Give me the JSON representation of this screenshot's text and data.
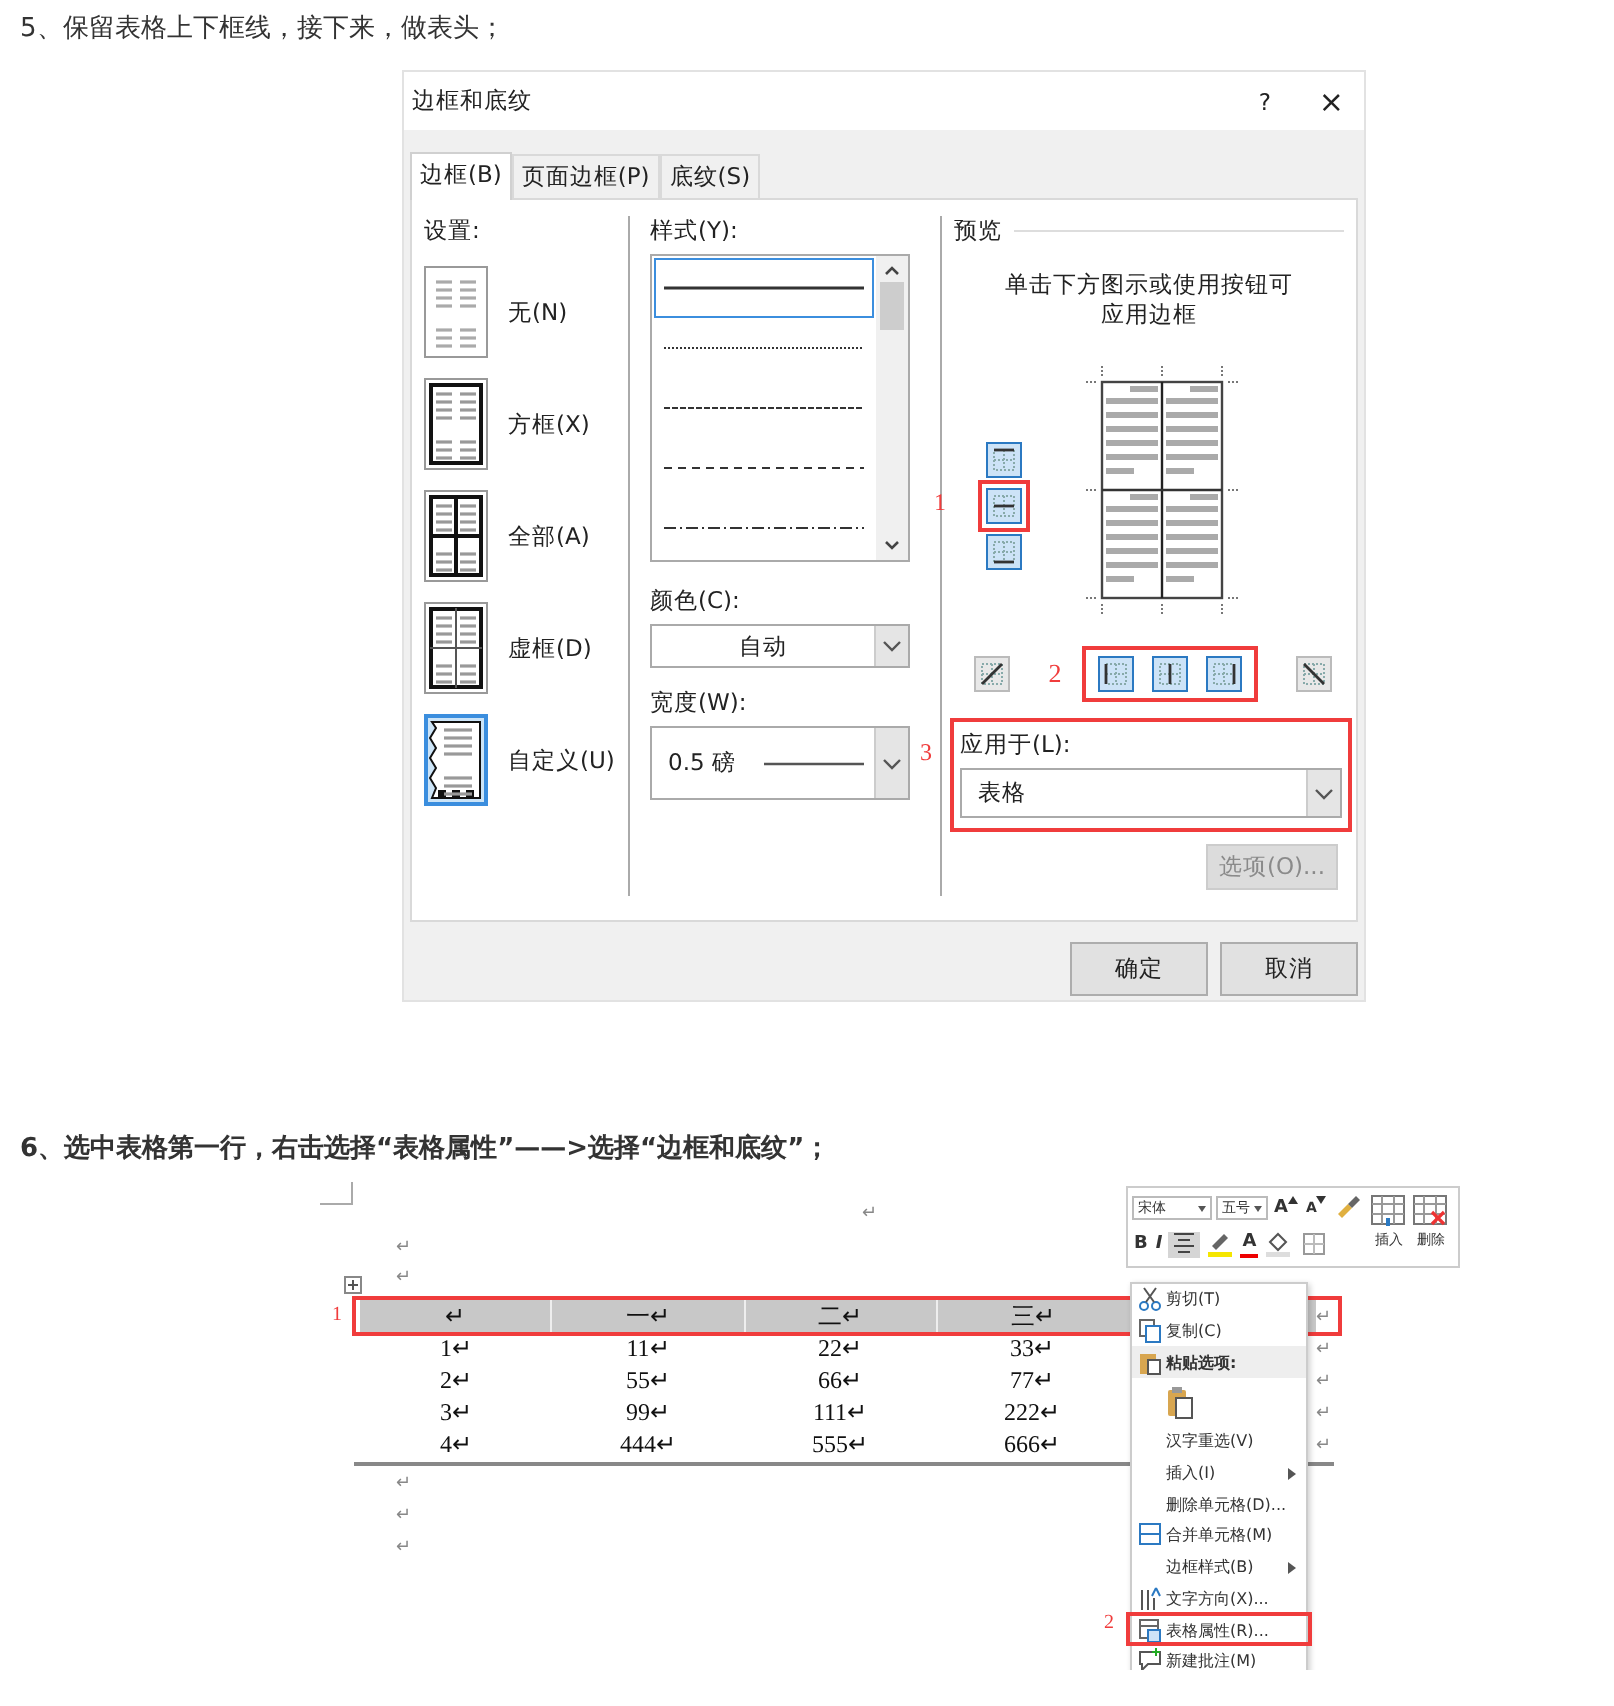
{
  "step5": {
    "text": "5、保留表格上下框线，接下来，做表头；"
  },
  "dialog": {
    "title": "边框和底纹",
    "help": "?",
    "close": "×",
    "tabs": [
      {
        "label": "边框(B)",
        "selected": true
      },
      {
        "label": "页面边框(P)",
        "selected": false
      },
      {
        "label": "底纹(S)",
        "selected": false
      }
    ],
    "settings": {
      "label": "设置:",
      "items": [
        {
          "label": "无(N)",
          "kind": "none",
          "selected": false
        },
        {
          "label": "方框(X)",
          "kind": "box",
          "selected": false
        },
        {
          "label": "全部(A)",
          "kind": "all",
          "selected": false
        },
        {
          "label": "虚框(D)",
          "kind": "grid",
          "selected": false
        },
        {
          "label": "自定义(U)",
          "kind": "custom",
          "selected": true
        }
      ]
    },
    "style": {
      "label": "样式(Y):",
      "options": [
        {
          "kind": "solid",
          "selected": true
        },
        {
          "kind": "dotted",
          "selected": false
        },
        {
          "kind": "fine-dash",
          "selected": false
        },
        {
          "kind": "dash",
          "selected": false
        },
        {
          "kind": "dash-dot",
          "selected": false
        }
      ]
    },
    "color": {
      "label": "颜色(C):",
      "value": "自动"
    },
    "width": {
      "label": "宽度(W):",
      "value": "0.5 磅"
    },
    "preview": {
      "label": "预览",
      "hint": "单击下方图示或使用按钮可应用边框"
    },
    "side_buttons": [
      {
        "kind": "top",
        "on": true
      },
      {
        "kind": "inside-h",
        "on": true
      },
      {
        "kind": "bottom",
        "on": true
      }
    ],
    "bottom_buttons": [
      {
        "kind": "diag-up",
        "on": false
      },
      {
        "kind": "left",
        "on": true
      },
      {
        "kind": "inside-v",
        "on": true
      },
      {
        "kind": "right",
        "on": true
      },
      {
        "kind": "diag-down",
        "on": false
      }
    ],
    "apply_to": {
      "label": "应用于(L):",
      "value": "表格"
    },
    "options_button": {
      "label": "选项(O)...",
      "disabled": true
    },
    "buttons": [
      {
        "label": "确定"
      },
      {
        "label": "取消"
      }
    ],
    "annotations": [
      "1",
      "2",
      "3"
    ]
  },
  "step6": {
    "text": "6、选中表格第一行，右击选择“表格属性”——>选择“边框和底纹”；"
  },
  "word": {
    "top_mark": "↵",
    "paragraphs_before": [
      "↵",
      "↵"
    ],
    "table": {
      "rows": [
        {
          "selected": true,
          "cells": [
            "↵",
            "一↵",
            "二↵",
            "三↵"
          ],
          "end": "↵"
        },
        {
          "selected": false,
          "cells": [
            "1↵",
            "11↵",
            "22↵",
            "33↵"
          ],
          "end": "↵"
        },
        {
          "selected": false,
          "cells": [
            "2↵",
            "55↵",
            "66↵",
            "77↵"
          ],
          "end": "↵"
        },
        {
          "selected": false,
          "cells": [
            "3↵",
            "99↵",
            "111↵",
            "222↵"
          ],
          "end": "↵"
        },
        {
          "selected": false,
          "cells": [
            "4↵",
            "444↵",
            "555↵",
            "666↵"
          ],
          "end": "↵"
        }
      ]
    },
    "paragraphs_after": [
      "↵",
      "↵",
      "↵"
    ],
    "mini_toolbar": {
      "font": "宋体",
      "size": "五号",
      "row1": [
        {
          "kind": "grow",
          "glyph": "A",
          "on": false
        },
        {
          "kind": "shrink",
          "glyph": "A",
          "on": false
        },
        {
          "kind": "brush",
          "on": false
        }
      ],
      "row2": [
        {
          "kind": "bold",
          "glyph": "B",
          "on": false
        },
        {
          "kind": "italic",
          "glyph": "I",
          "on": false
        },
        {
          "kind": "center",
          "on": true
        },
        {
          "kind": "highlight",
          "on": false
        },
        {
          "kind": "font-color",
          "glyph": "A",
          "on": false
        },
        {
          "kind": "shading",
          "on": false
        },
        {
          "kind": "borders",
          "on": false
        }
      ],
      "insert": "插入",
      "delete": "删除"
    },
    "menu": [
      {
        "kind": "item",
        "label": "剪切(T)",
        "submenu": false,
        "marked": false
      },
      {
        "kind": "item",
        "label": "复制(C)",
        "submenu": false,
        "marked": false
      },
      {
        "kind": "header",
        "label": "粘贴选项:"
      },
      {
        "kind": "paste"
      },
      {
        "kind": "item",
        "label": "汉字重选(V)",
        "submenu": false,
        "marked": false
      },
      {
        "kind": "item",
        "label": "插入(I)",
        "submenu": true,
        "marked": false
      },
      {
        "kind": "item",
        "label": "删除单元格(D)...",
        "submenu": false,
        "marked": false
      },
      {
        "kind": "item",
        "label": "合并单元格(M)",
        "submenu": false,
        "marked": false
      },
      {
        "kind": "item",
        "label": "边框样式(B)",
        "submenu": true,
        "marked": false
      },
      {
        "kind": "item",
        "label": "文字方向(X)...",
        "submenu": false,
        "marked": false
      },
      {
        "kind": "item",
        "label": "表格属性(R)...",
        "submenu": false,
        "marked": true
      },
      {
        "kind": "item",
        "label": "新建批注(M)",
        "submenu": false,
        "marked": false
      }
    ],
    "annotations": [
      "1",
      "2"
    ]
  }
}
